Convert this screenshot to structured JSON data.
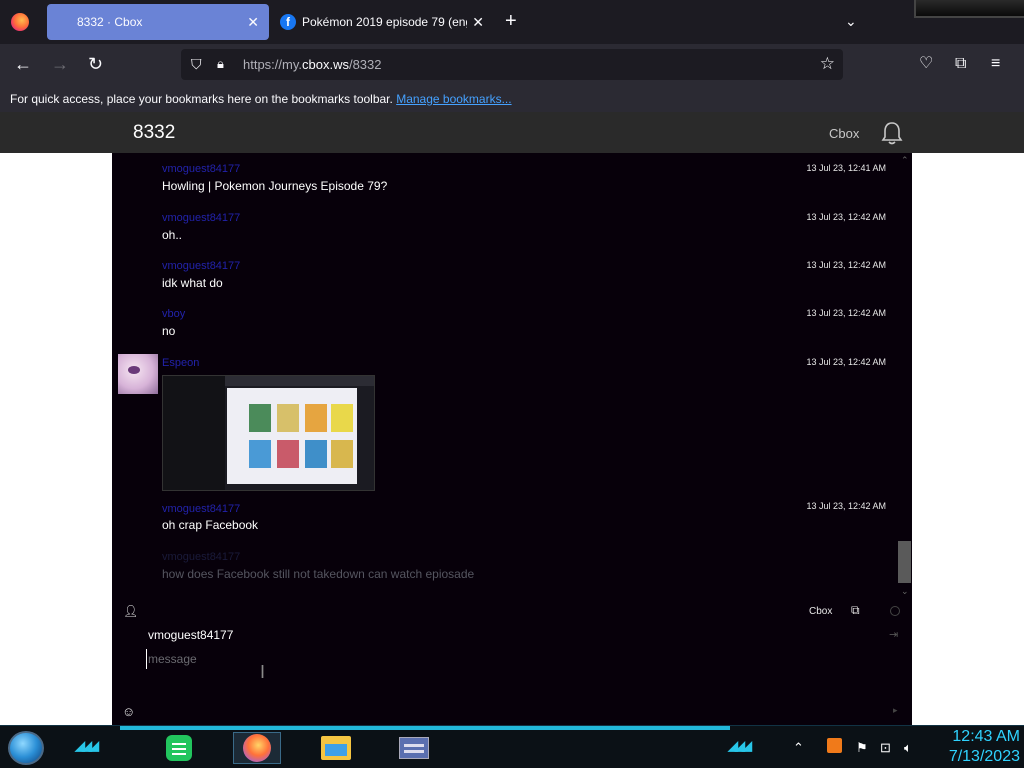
{
  "browser": {
    "tabs": [
      {
        "title": "8332 · Cbox",
        "active": true
      },
      {
        "title": "Pokémon 2019 episode 79 (eng",
        "active": false
      }
    ],
    "new_tab_icon": "plus-icon",
    "url_prefix": "https://my.",
    "url_host": "cbox.ws",
    "url_path": "/8332",
    "bookmarks_text": "For quick access, place your bookmarks here on the bookmarks toolbar.",
    "bookmarks_link": "Manage bookmarks..."
  },
  "cbox": {
    "title": "8332",
    "link": "Cbox"
  },
  "messages": [
    {
      "name": "vmoguest84177",
      "time": "13 Jul 23, 12:41 AM",
      "text": "Howling | Pokemon Journeys Episode 79?"
    },
    {
      "name": "vmoguest84177",
      "time": "13 Jul 23, 12:42 AM",
      "text": "oh.."
    },
    {
      "name": "vmoguest84177",
      "time": "13 Jul 23, 12:42 AM",
      "text": "idk what do"
    },
    {
      "name": "vboy",
      "time": "13 Jul 23, 12:42 AM",
      "text": "no"
    },
    {
      "name": "Espeon",
      "time": "13 Jul 23, 12:42 AM",
      "text": ""
    },
    {
      "name": "vmoguest84177",
      "time": "13 Jul 23, 12:42 AM",
      "text": "oh crap Facebook"
    },
    {
      "name": "vmoguest84177",
      "time": "",
      "text": "how does Facebook still not takedown can watch epiosade"
    }
  ],
  "input": {
    "username": "vmoguest84177",
    "placeholder": "message",
    "cbox_label": "Cbox"
  },
  "taskbar": {
    "time": "12:43 AM",
    "date": "7/13/2023"
  },
  "colors": {
    "chat_bg": "#07000a",
    "username": "#2222aa",
    "clock": "#2fd3ff",
    "active_tab": "#6a83d6"
  }
}
